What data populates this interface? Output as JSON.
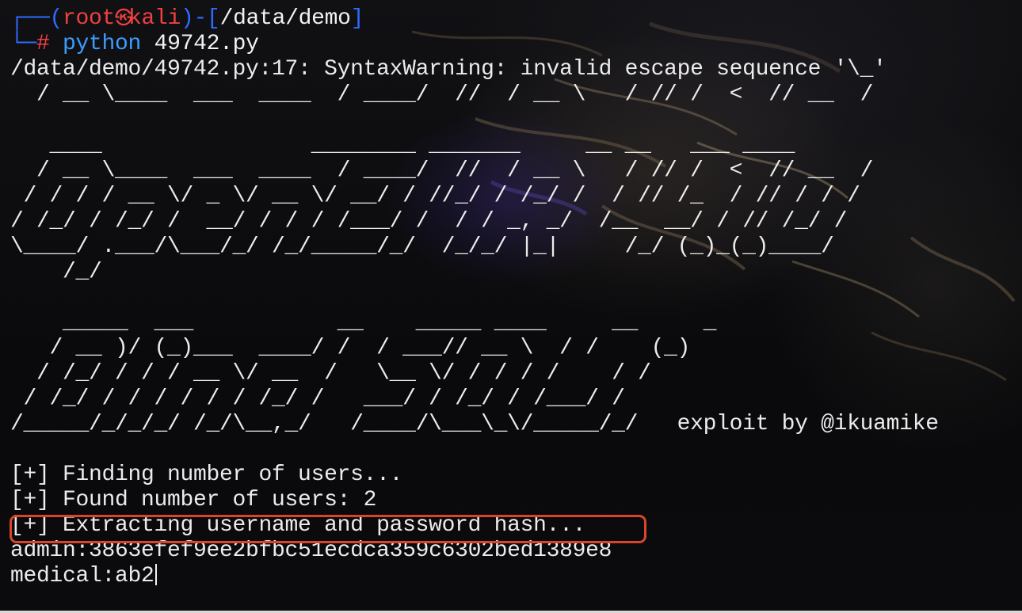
{
  "prompt": {
    "user": "root",
    "host": "kali",
    "cwd": "/data/demo",
    "symbol": "#",
    "command_name": "python",
    "command_args": "49742.py",
    "skull_glyph": "㉿"
  },
  "warning_line": "/data/demo/49742.py:17: SyntaxWarning: invalid escape sequence '\\_'",
  "ascii_banner_preview": "  / __ \\____  ___  ____  / ____/  //  / __ \\   / // /  <  // __  /",
  "ascii_banner_lines": [
    "   ____                ________ _______     __ __   ___ ____",
    "  / __ \\____  ___  ____  / ____/  //  / __ \\   / // /  <  // __  /",
    " / / / / __ \\/ _ \\/ __ \\/ __/ / //_/ / /_/ /  / // /_  / // / / /",
    "/ /_/ / /_/ /  __/ / / / /___/ /  / / _, _/  /__  __/ / // /_/ /",
    "\\____/ .___/\\___/_/ /_/_____/_/  /_/_/ |_|     /_/ (_)_(_)____/",
    "    /_/",
    "",
    "    _____  ___           __    _____ ____     __     _",
    "   / __ )/ (_)___  ____/ /  / ___// __ \\  / /    (_)",
    "  / /_/ / / / __ \\/ __  /   \\__ \\/ / / / /    / /",
    " / /_/ / / / / / / /_/ /   ___/ / /_/ / /___/ /",
    "/_____/_/_/_/ /_/\\__,_/   /____/\\___\\_\\/_____/_/   exploit by @ikuamike"
  ],
  "output_lines": [
    "[+] Finding number of users...",
    "[+] Found number of users: 2",
    "[+] Extracting username and password hash...",
    "admin:3863efef9ee2bfbc51ecdca359c6302bed1389e8",
    "medical:ab2"
  ],
  "colors": {
    "prompt_frame": "#2f6bff",
    "prompt_user": "#f04040",
    "command": "#3b9dff",
    "text": "#ececec",
    "highlight_border": "#d9452a"
  }
}
